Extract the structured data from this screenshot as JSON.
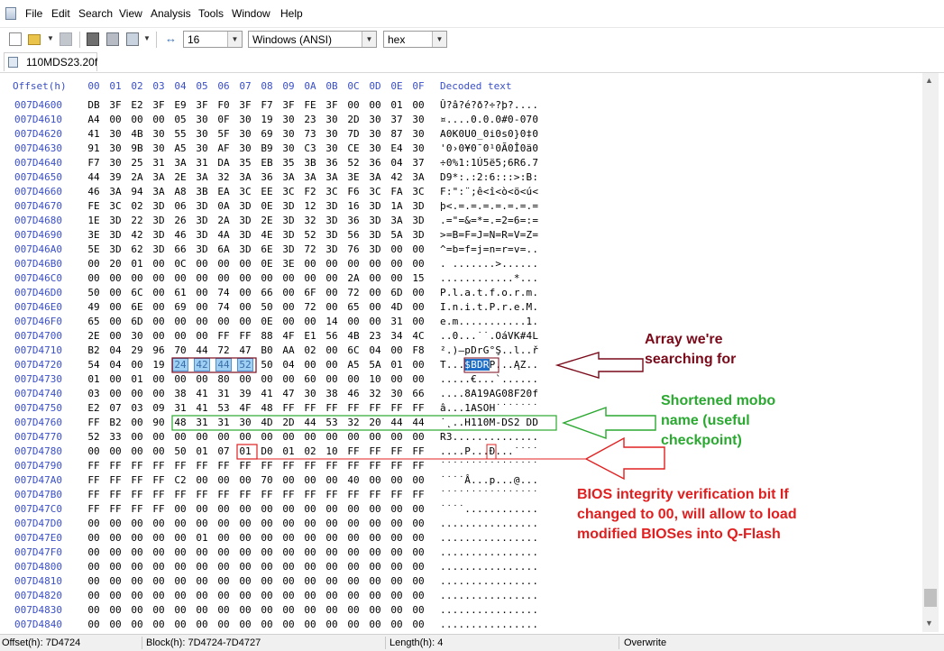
{
  "menubar": {
    "items": [
      "File",
      "Edit",
      "Search",
      "View",
      "Analysis",
      "Tools",
      "Window",
      "Help"
    ]
  },
  "toolbar": {
    "bytes_per_row": "16",
    "charset": "Windows (ANSI)",
    "display_mode": "hex"
  },
  "tab": {
    "filename": "110MDS23.20f"
  },
  "editor": {
    "offset_header": "Offset(h)",
    "column_headers": [
      "00",
      "01",
      "02",
      "03",
      "04",
      "05",
      "06",
      "07",
      "08",
      "09",
      "0A",
      "0B",
      "0C",
      "0D",
      "0E",
      "0F"
    ],
    "decoded_header": "Decoded text",
    "rows": [
      {
        "offset": "007D4600",
        "bytes": "DB 3F E2 3F E9 3F F0 3F F7 3F FE 3F 00 00 01 00",
        "text": "Û?â?é?ð?÷?þ?...."
      },
      {
        "offset": "007D4610",
        "bytes": "A4 00 00 00 05 30 0F 30 19 30 23 30 2D 30 37 30",
        "text": "¤....0.0.0#0-070"
      },
      {
        "offset": "007D4620",
        "bytes": "41 30 4B 30 55 30 5F 30 69 30 73 30 7D 30 87 30",
        "text": "A0K0U0_0i0s0}0‡0"
      },
      {
        "offset": "007D4630",
        "bytes": "91 30 9B 30 A5 30 AF 30 B9 30 C3 30 CE 30 E4 30",
        "text": "'0›0¥0¯0¹0Ã0Î0ä0"
      },
      {
        "offset": "007D4640",
        "bytes": "F7 30 25 31 3A 31 DA 35 EB 35 3B 36 52 36 04 37",
        "text": "÷0%1:1Ú5ë5;6R6.7"
      },
      {
        "offset": "007D4650",
        "bytes": "44 39 2A 3A 2E 3A 32 3A 36 3A 3A 3A 3E 3A 42 3A",
        "text": "D9*:.:2:6:::>:B:"
      },
      {
        "offset": "007D4660",
        "bytes": "46 3A 94 3A A8 3B EA 3C EE 3C F2 3C F6 3C FA 3C",
        "text": "F:\":¨;ê<î<ò<ö<ú<"
      },
      {
        "offset": "007D4670",
        "bytes": "FE 3C 02 3D 06 3D 0A 3D 0E 3D 12 3D 16 3D 1A 3D",
        "text": "þ<.=.=.=.=.=.=.="
      },
      {
        "offset": "007D4680",
        "bytes": "1E 3D 22 3D 26 3D 2A 3D 2E 3D 32 3D 36 3D 3A 3D",
        "text": ".=\"=&=*=.=2=6=:="
      },
      {
        "offset": "007D4690",
        "bytes": "3E 3D 42 3D 46 3D 4A 3D 4E 3D 52 3D 56 3D 5A 3D",
        "text": ">=B=F=J=N=R=V=Z="
      },
      {
        "offset": "007D46A0",
        "bytes": "5E 3D 62 3D 66 3D 6A 3D 6E 3D 72 3D 76 3D 00 00",
        "text": "^=b=f=j=n=r=v=.."
      },
      {
        "offset": "007D46B0",
        "bytes": "00 20 01 00 0C 00 00 00 0E 3E 00 00 00 00 00 00",
        "text": ". .......>......"
      },
      {
        "offset": "007D46C0",
        "bytes": "00 00 00 00 00 00 00 00 00 00 00 00 2A 00 00 15",
        "text": "............*..."
      },
      {
        "offset": "007D46D0",
        "bytes": "50 00 6C 00 61 00 74 00 66 00 6F 00 72 00 6D 00",
        "text": "P.l.a.t.f.o.r.m."
      },
      {
        "offset": "007D46E0",
        "bytes": "49 00 6E 00 69 00 74 00 50 00 72 00 65 00 4D 00",
        "text": "I.n.i.t.P.r.e.M."
      },
      {
        "offset": "007D46F0",
        "bytes": "65 00 6D 00 00 00 00 00 0E 00 00 14 00 00 31 00",
        "text": "e.m...........1."
      },
      {
        "offset": "007D4700",
        "bytes": "2E 00 30 00 00 00 FF FF 88 4F E1 56 4B 23 34 4C",
        "text": "..0...˙˙.OáVK#4L"
      },
      {
        "offset": "007D4710",
        "bytes": "B2 04 29 96 70 44 72 47 B0 AA 02 00 6C 04 00 F8",
        "text": "².)–pDrG°Ş..l..ř"
      },
      {
        "offset": "007D4720",
        "bytes": "54 04 00 19 24 42 44 52 50 04 00 00 A5 5A 01 00",
        "text": "T...$BDRP...ĄZ.."
      },
      {
        "offset": "007D4730",
        "bytes": "01 00 01 00 00 00 80 00 00 00 60 00 00 10 00 00",
        "text": ".....€...`......"
      },
      {
        "offset": "007D4740",
        "bytes": "03 00 00 00 38 41 31 39 41 47 30 38 46 32 30 66",
        "text": "....8A19AG08F20f"
      },
      {
        "offset": "007D4750",
        "bytes": "E2 07 03 09 31 41 53 4F 48 FF FF FF FF FF FF FF",
        "text": "â...1ASOH˙˙˙˙˙˙˙"
      },
      {
        "offset": "007D4760",
        "bytes": "FF B2 00 90 48 31 31 30 4D 2D 44 53 32 20 44 44",
        "text": "˙˛..H110M-DS2 DD"
      },
      {
        "offset": "007D4770",
        "bytes": "52 33 00 00 00 00 00 00 00 00 00 00 00 00 00 00",
        "text": "R3.............."
      },
      {
        "offset": "007D4780",
        "bytes": "00 00 00 00 50 01 07 01 D0 01 02 10 FF FF FF FF",
        "text": "....P...Đ...˙˙˙˙"
      },
      {
        "offset": "007D4790",
        "bytes": "FF FF FF FF FF FF FF FF FF FF FF FF FF FF FF FF",
        "text": "˙˙˙˙˙˙˙˙˙˙˙˙˙˙˙˙"
      },
      {
        "offset": "007D47A0",
        "bytes": "FF FF FF FF C2 00 00 00 70 00 00 00 40 00 00 00",
        "text": "˙˙˙˙Â...p...@..."
      },
      {
        "offset": "007D47B0",
        "bytes": "FF FF FF FF FF FF FF FF FF FF FF FF FF FF FF FF",
        "text": "˙˙˙˙˙˙˙˙˙˙˙˙˙˙˙˙"
      },
      {
        "offset": "007D47C0",
        "bytes": "FF FF FF FF 00 00 00 00 00 00 00 00 00 00 00 00",
        "text": "˙˙˙˙............"
      },
      {
        "offset": "007D47D0",
        "bytes": "00 00 00 00 00 00 00 00 00 00 00 00 00 00 00 00",
        "text": "................"
      },
      {
        "offset": "007D47E0",
        "bytes": "00 00 00 00 00 01 00 00 00 00 00 00 00 00 00 00",
        "text": "................"
      },
      {
        "offset": "007D47F0",
        "bytes": "00 00 00 00 00 00 00 00 00 00 00 00 00 00 00 00",
        "text": "................"
      },
      {
        "offset": "007D4800",
        "bytes": "00 00 00 00 00 00 00 00 00 00 00 00 00 00 00 00",
        "text": "................"
      },
      {
        "offset": "007D4810",
        "bytes": "00 00 00 00 00 00 00 00 00 00 00 00 00 00 00 00",
        "text": "................"
      },
      {
        "offset": "007D4820",
        "bytes": "00 00 00 00 00 00 00 00 00 00 00 00 00 00 00 00",
        "text": "................"
      },
      {
        "offset": "007D4830",
        "bytes": "00 00 00 00 00 00 00 00 00 00 00 00 00 00 00 00",
        "text": "................"
      },
      {
        "offset": "007D4840",
        "bytes": "00 00 00 00 00 00 00 00 00 00 00 00 00 00 00 00",
        "text": "................"
      }
    ]
  },
  "annotations": {
    "array": "Array we're searching for",
    "mobo": "Shortened mobo name (useful checkpoint)",
    "bios": "BIOS integrity verification bit If changed to 00, will allow to load modified BIOSes into Q-Flash",
    "colors": {
      "array": "#7a0a1a",
      "mobo": "#2aa830",
      "bios": "#e02020"
    }
  },
  "statusbar": {
    "offset": "Offset(h): 7D4724",
    "block": "Block(h): 7D4724-7D4727",
    "length": "Length(h): 4",
    "mode": "Overwrite"
  }
}
